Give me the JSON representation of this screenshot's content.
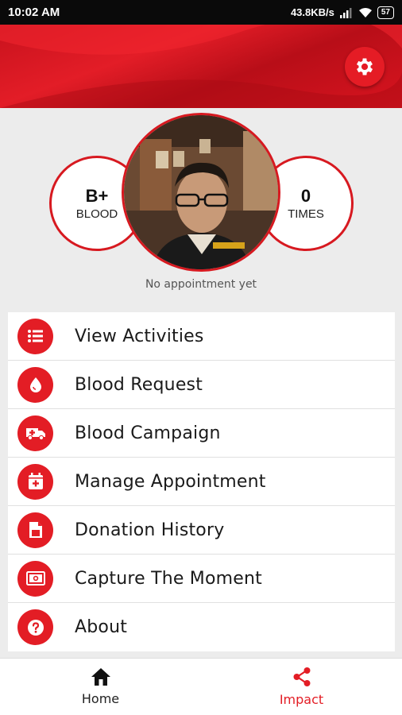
{
  "status_bar": {
    "time": "10:02 AM",
    "network_speed": "43.8KB/s",
    "battery": "57"
  },
  "header": {
    "settings_icon": "gear-icon",
    "accent_color": "#e31d25"
  },
  "profile": {
    "blood_type": "B+",
    "blood_label": "BLOOD",
    "donation_count": "0",
    "donation_label": "TIMES",
    "appointment_status": "No appointment yet"
  },
  "menu": {
    "items": [
      {
        "label": "View Activities",
        "icon": "list-icon"
      },
      {
        "label": "Blood Request",
        "icon": "blood-drop-icon"
      },
      {
        "label": "Blood Campaign",
        "icon": "ambulance-icon"
      },
      {
        "label": "Manage Appointment",
        "icon": "calendar-plus-icon"
      },
      {
        "label": "Donation History",
        "icon": "document-icon"
      },
      {
        "label": "Capture The Moment",
        "icon": "photo-icon"
      },
      {
        "label": "About",
        "icon": "help-icon"
      }
    ]
  },
  "bottom_nav": {
    "items": [
      {
        "label": "Home",
        "icon": "home-icon",
        "active": false
      },
      {
        "label": "Impact",
        "icon": "share-icon",
        "active": true
      }
    ]
  }
}
